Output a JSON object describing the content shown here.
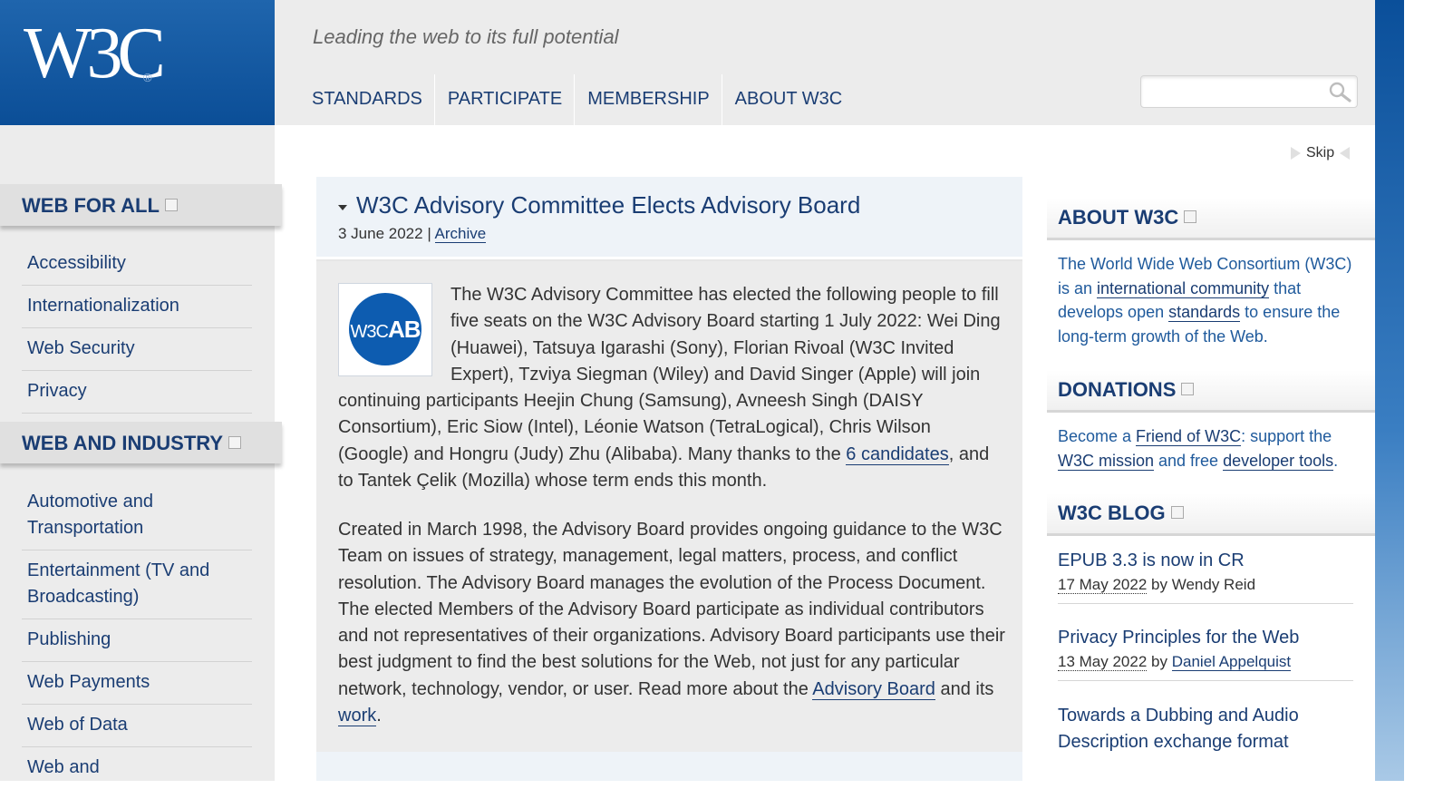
{
  "header": {
    "logo_text": "W3C",
    "logo_reg": "®",
    "tagline": "Leading the web to its full potential",
    "nav": [
      "STANDARDS",
      "PARTICIPATE",
      "MEMBERSHIP",
      "ABOUT W3C"
    ],
    "search": {
      "placeholder": "",
      "icon": "search-icon"
    }
  },
  "skip_label": "Skip",
  "left_sidebar": {
    "web_for_all": {
      "title": "WEB FOR ALL",
      "items": [
        "Accessibility",
        "Internationalization",
        "Web Security",
        "Privacy"
      ]
    },
    "web_and_industry": {
      "title": "WEB AND INDUSTRY",
      "items": [
        "Automotive and Transportation",
        "Entertainment (TV and Broadcasting)",
        "Publishing",
        "Web Payments",
        "Web of Data",
        "Web and"
      ]
    }
  },
  "article": {
    "title": "W3C Advisory Committee Elects Advisory Board",
    "date": "3 June 2022",
    "separator": "|",
    "archive_link": "Archive",
    "logo_text_w3c": "W3C",
    "logo_text_ab": "AB",
    "para1": {
      "before": "The W3C Advisory Committee has elected the following people to fill five seats on the W3C Advisory Board starting 1 July 2022: Wei Ding (Huawei), Tatsuya Igarashi (Sony), Florian Rivoal (W3C Invited Expert), Tzviya Siegman (Wiley) and David Singer (Apple) will join continuing participants Heejin Chung (Samsung), Avneesh Singh (DAISY Consortium), Eric Siow (Intel), Léonie Watson (TetraLogical), Chris Wilson (Google) and Hongru (Judy) Zhu (Alibaba). Many thanks to the ",
      "link": "6 candidates",
      "after": ", and to Tantek Çelik (Mozilla) whose term ends this month."
    },
    "para2": {
      "before": "Created in March 1998, the Advisory Board provides ongoing guidance to the W3C Team on issues of strategy, management, legal matters, process, and conflict resolution. The Advisory Board manages the evolution of the Process Document. The elected Members of the Advisory Board participate as individual contributors and not representatives of their organizations. Advisory Board participants use their best judgment to find the best solutions for the Web, not just for any particular network, technology, vendor, or user. Read more about the ",
      "link1": "Advisory Board",
      "middle": " and its ",
      "link2": "work",
      "after": "."
    }
  },
  "right_sidebar": {
    "about": {
      "title": "ABOUT W3C",
      "t1": "The World Wide Web Consortium (W3C) is an ",
      "link1": "international community",
      "t2": " that develops open ",
      "link2": "standards",
      "t3": " to ensure the long-term growth of the Web."
    },
    "donations": {
      "title": "DONATIONS",
      "t1": "Become a ",
      "link1": "Friend of W3C",
      "t2": ": support the ",
      "link2": "W3C mission",
      "t3": " and free ",
      "link3": "developer tools",
      "t4": "."
    },
    "blog": {
      "title": "W3C BLOG",
      "posts": [
        {
          "title": "EPUB 3.3 is now in CR",
          "date": "17 May 2022",
          "by": "by",
          "author": "Wendy Reid",
          "author_linked": false
        },
        {
          "title": "Privacy Principles for the Web",
          "date": "13 May 2022",
          "by": "by",
          "author": "Daniel Appelquist",
          "author_linked": true
        },
        {
          "title": "Towards a Dubbing and Audio Description exchange format"
        }
      ]
    }
  },
  "colors": {
    "brand_blue": "#0b4e97",
    "link": "#1a3d73",
    "band_gray": "#ececec"
  }
}
